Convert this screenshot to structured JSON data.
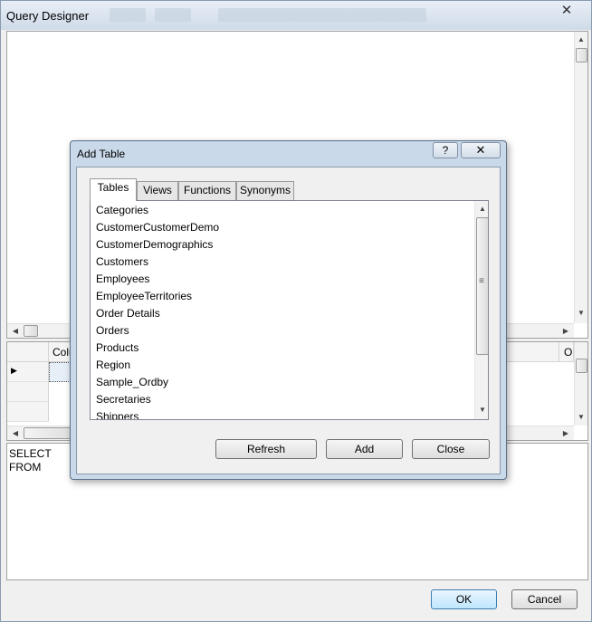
{
  "main_window": {
    "title": "Query Designer",
    "close_glyph": "✕"
  },
  "grid": {
    "column_header": "Colu",
    "right_header": "O",
    "row_marker": "▶"
  },
  "sql": {
    "line1": "SELECT",
    "line2": "FROM"
  },
  "buttons": {
    "ok": "OK",
    "cancel": "Cancel"
  },
  "dialog": {
    "title": "Add Table",
    "help_glyph": "?",
    "close_glyph": "✕",
    "tabs": [
      {
        "label": "Tables"
      },
      {
        "label": "Views"
      },
      {
        "label": "Functions"
      },
      {
        "label": "Synonyms"
      }
    ],
    "tables": [
      "Categories",
      "CustomerCustomerDemo",
      "CustomerDemographics",
      "Customers",
      "Employees",
      "EmployeeTerritories",
      "Order Details",
      "Orders",
      "Products",
      "Region",
      "Sample_Ordby",
      "Secretaries",
      "Shippers"
    ],
    "refresh_label": "Refresh",
    "add_label": "Add",
    "close_label": "Close"
  },
  "icons": {
    "scroll_up": "▲",
    "scroll_down": "▼",
    "scroll_left": "◀",
    "scroll_right": "▶",
    "grip": "≡"
  }
}
